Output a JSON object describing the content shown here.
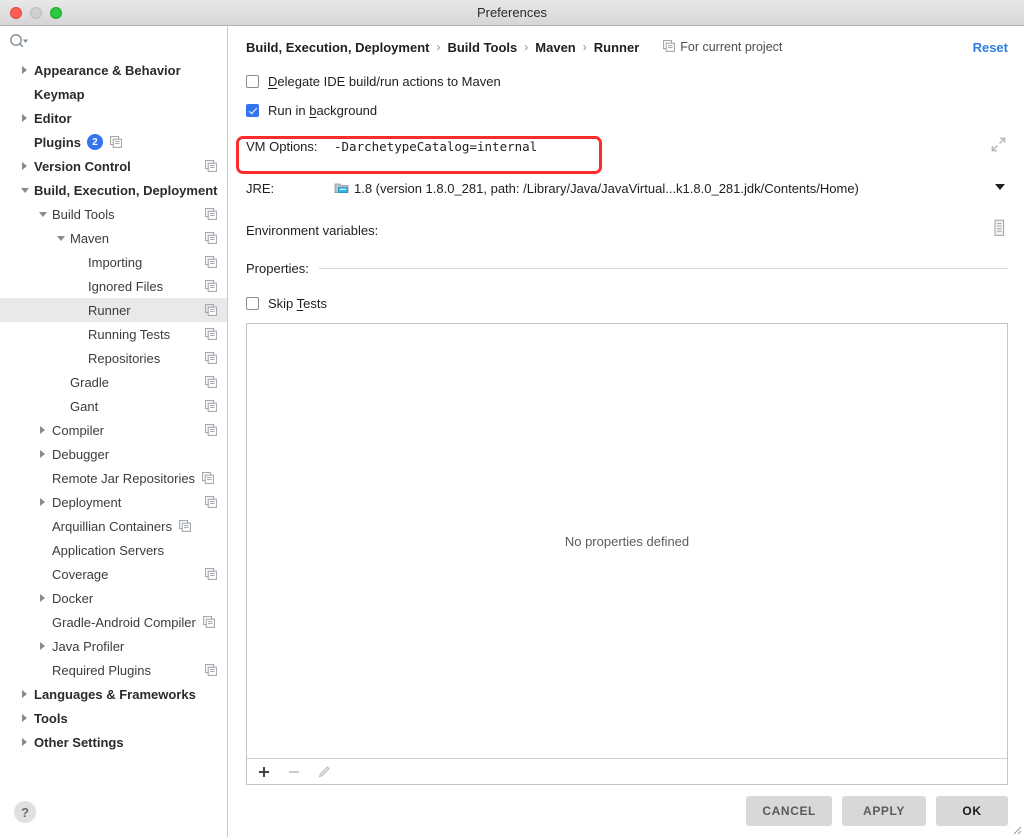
{
  "window": {
    "title": "Preferences",
    "traffic_lights": [
      "close-button",
      "minimize-button",
      "maximize-button"
    ]
  },
  "sidebar": {
    "search_placeholder": "",
    "search_icon": "search-icon",
    "help_label": "?",
    "items": [
      {
        "label": "Appearance & Behavior",
        "indent": 0,
        "twisty": "collapsed",
        "bold": true,
        "icon": false
      },
      {
        "label": "Keymap",
        "indent": 0,
        "twisty": "none",
        "bold": true,
        "icon": false
      },
      {
        "label": "Editor",
        "indent": 0,
        "twisty": "collapsed",
        "bold": true,
        "icon": false
      },
      {
        "label": "Plugins",
        "indent": 0,
        "twisty": "none",
        "bold": true,
        "icon": true,
        "badge": "2",
        "icon_right": false
      },
      {
        "label": "Version Control",
        "indent": 0,
        "twisty": "collapsed",
        "bold": true,
        "icon": true,
        "icon_right": true
      },
      {
        "label": "Build, Execution, Deployment",
        "indent": 0,
        "twisty": "expanded",
        "bold": true,
        "icon": false
      },
      {
        "label": "Build Tools",
        "indent": 1,
        "twisty": "expanded",
        "bold": false,
        "icon": true,
        "icon_right": true
      },
      {
        "label": "Maven",
        "indent": 2,
        "twisty": "expanded",
        "bold": false,
        "icon": true,
        "icon_right": true
      },
      {
        "label": "Importing",
        "indent": 3,
        "twisty": "none",
        "bold": false,
        "icon": true,
        "icon_right": true
      },
      {
        "label": "Ignored Files",
        "indent": 3,
        "twisty": "none",
        "bold": false,
        "icon": true,
        "icon_right": true
      },
      {
        "label": "Runner",
        "indent": 3,
        "twisty": "none",
        "bold": false,
        "icon": true,
        "icon_right": true,
        "selected": true
      },
      {
        "label": "Running Tests",
        "indent": 3,
        "twisty": "none",
        "bold": false,
        "icon": true,
        "icon_right": true
      },
      {
        "label": "Repositories",
        "indent": 3,
        "twisty": "none",
        "bold": false,
        "icon": true,
        "icon_right": true
      },
      {
        "label": "Gradle",
        "indent": 2,
        "twisty": "none",
        "bold": false,
        "icon": true,
        "icon_right": true
      },
      {
        "label": "Gant",
        "indent": 2,
        "twisty": "none",
        "bold": false,
        "icon": true,
        "icon_right": true
      },
      {
        "label": "Compiler",
        "indent": 1,
        "twisty": "collapsed",
        "bold": false,
        "icon": true,
        "icon_right": true
      },
      {
        "label": "Debugger",
        "indent": 1,
        "twisty": "collapsed",
        "bold": false,
        "icon": false
      },
      {
        "label": "Remote Jar Repositories",
        "indent": 1,
        "twisty": "none",
        "bold": false,
        "icon": true,
        "icon_right": false
      },
      {
        "label": "Deployment",
        "indent": 1,
        "twisty": "collapsed",
        "bold": false,
        "icon": true,
        "icon_right": true
      },
      {
        "label": "Arquillian Containers",
        "indent": 1,
        "twisty": "none",
        "bold": false,
        "icon": true,
        "icon_right": false
      },
      {
        "label": "Application Servers",
        "indent": 1,
        "twisty": "none",
        "bold": false,
        "icon": false
      },
      {
        "label": "Coverage",
        "indent": 1,
        "twisty": "none",
        "bold": false,
        "icon": true,
        "icon_right": true
      },
      {
        "label": "Docker",
        "indent": 1,
        "twisty": "collapsed",
        "bold": false,
        "icon": false
      },
      {
        "label": "Gradle-Android Compiler",
        "indent": 1,
        "twisty": "none",
        "bold": false,
        "icon": true,
        "icon_right": false
      },
      {
        "label": "Java Profiler",
        "indent": 1,
        "twisty": "collapsed",
        "bold": false,
        "icon": false
      },
      {
        "label": "Required Plugins",
        "indent": 1,
        "twisty": "none",
        "bold": false,
        "icon": true,
        "icon_right": true
      },
      {
        "label": "Languages & Frameworks",
        "indent": 0,
        "twisty": "collapsed",
        "bold": true,
        "icon": false
      },
      {
        "label": "Tools",
        "indent": 0,
        "twisty": "collapsed",
        "bold": true,
        "icon": false
      },
      {
        "label": "Other Settings",
        "indent": 0,
        "twisty": "collapsed",
        "bold": true,
        "icon": false
      }
    ]
  },
  "main": {
    "breadcrumb": [
      "Build, Execution, Deployment",
      "Build Tools",
      "Maven",
      "Runner"
    ],
    "breadcrumb_separator": "›",
    "scope_label": "For current project",
    "scope_icon": "project-scope-icon",
    "reset_label": "Reset",
    "delegate": {
      "label_pre": "",
      "mnemonic": "D",
      "label_post": "elegate IDE build/run actions to Maven",
      "checked": false
    },
    "run_in_background": {
      "label_pre": "Run in ",
      "mnemonic": "b",
      "label_post": "ackground",
      "checked": true
    },
    "vm_options": {
      "label": "VM Options:",
      "value": "-DarchetypeCatalog=internal",
      "expand_icon": "expand-icon"
    },
    "jre": {
      "label": "JRE:",
      "icon": "jdk-folder-icon",
      "value": "1.8 (version 1.8.0_281, path: /Library/Java/JavaVirtual...k1.8.0_281.jdk/Contents/Home)",
      "dropdown_icon": "chevron-down-icon"
    },
    "environment_variables": {
      "label": "Environment variables:",
      "value": "",
      "browse_icon": "env-vars-icon"
    },
    "properties_section_label": "Properties:",
    "skip_tests": {
      "label_pre": "Skip ",
      "mnemonic": "T",
      "label_post": "ests",
      "checked": false
    },
    "properties_table": {
      "empty_text": "No properties defined",
      "toolbar": [
        {
          "name": "add-property-button",
          "glyph": "+",
          "enabled": true
        },
        {
          "name": "remove-property-button",
          "glyph": "−",
          "enabled": false
        },
        {
          "name": "edit-property-button",
          "glyph": "pencil-icon",
          "enabled": false
        }
      ]
    }
  },
  "footer": {
    "cancel_label": "CANCEL",
    "apply_label": "APPLY",
    "ok_label": "OK"
  },
  "annotation": {
    "type": "red-rectangle-highlight",
    "targets": "vm-options-row"
  },
  "colors": {
    "accent_blue": "#3574f0",
    "link_blue": "#2f7de1",
    "annotation_red": "#fb2c2c",
    "selection_gray": "#e9e9e9",
    "button_gray": "#d8d8d8"
  }
}
